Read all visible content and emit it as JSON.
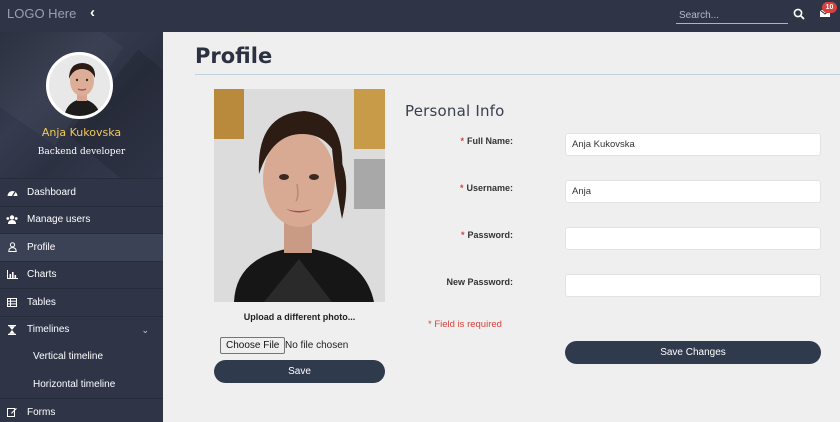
{
  "header": {
    "logo": "LOGO Here",
    "collapse_icon": "chevron-left-icon",
    "search_placeholder": "Search...",
    "search_icon": "search-icon",
    "mail_icon": "envelope-icon",
    "notification_count": "10"
  },
  "sidebar": {
    "user_name": "Anja Kukovska",
    "user_role": "Backend developer",
    "items": [
      {
        "label": "Dashboard",
        "icon": "dashboard-icon"
      },
      {
        "label": "Manage users",
        "icon": "users-icon"
      },
      {
        "label": "Profile",
        "icon": "user-icon",
        "active": true
      },
      {
        "label": "Charts",
        "icon": "bar-chart-icon"
      },
      {
        "label": "Tables",
        "icon": "table-icon"
      },
      {
        "label": "Timelines",
        "icon": "hourglass-icon",
        "expanded": true
      },
      {
        "label": "Vertical timeline",
        "sub": true
      },
      {
        "label": "Horizontal timeline",
        "sub": true
      },
      {
        "label": "Forms",
        "icon": "edit-icon"
      }
    ]
  },
  "main": {
    "page_title": "Profile",
    "upload_label": "Upload a different photo...",
    "file_button": "Choose File",
    "file_status": "No file chosen",
    "save_button": "Save",
    "section_title": "Personal Info",
    "fields": [
      {
        "label": "Full Name:",
        "required": true,
        "value": "Anja Kukovska"
      },
      {
        "label": "Username:",
        "required": true,
        "value": "Anja"
      },
      {
        "label": "Password:",
        "required": true,
        "value": ""
      },
      {
        "label": "New Password:",
        "required": false,
        "value": ""
      }
    ],
    "required_note": "* Field is required",
    "save_changes_button": "Save Changes"
  },
  "colors": {
    "sidebar_bg": "#2f3547",
    "accent_name": "#f0c95a",
    "required": "#d9413b",
    "button_bg": "#2f3a4d"
  }
}
